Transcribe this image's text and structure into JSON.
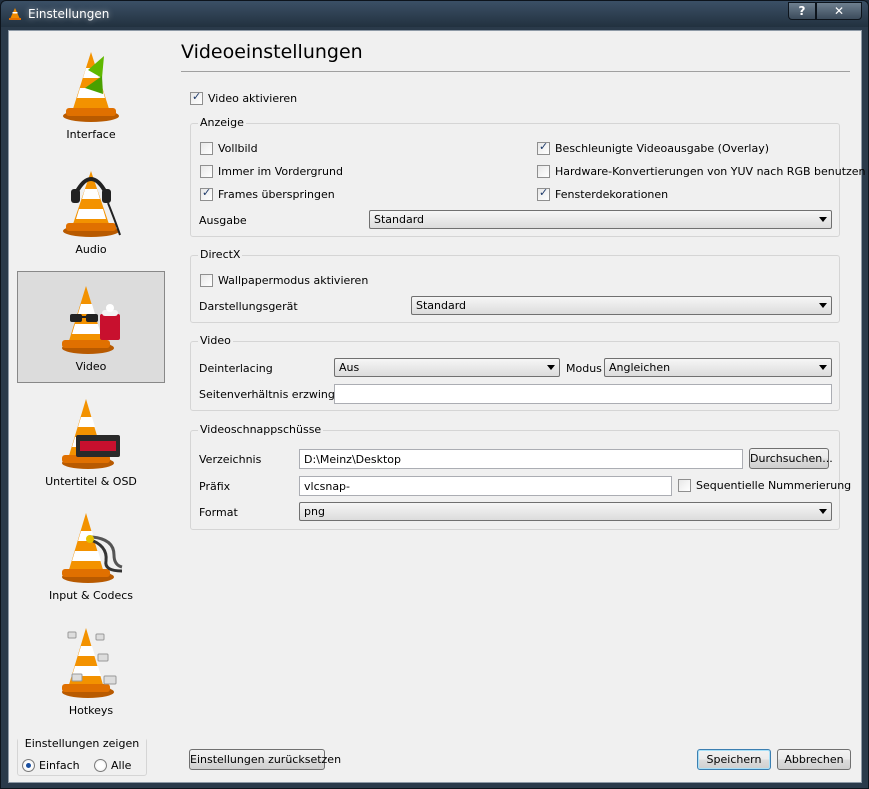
{
  "window": {
    "title": "Einstellungen",
    "help": "?",
    "close": "✕"
  },
  "sidebar": {
    "items": [
      {
        "label": "Interface",
        "icon": "vlc-cone-icon"
      },
      {
        "label": "Audio",
        "icon": "vlc-cone-headphones-icon"
      },
      {
        "label": "Video",
        "icon": "vlc-cone-glasses-icon"
      },
      {
        "label": "Untertitel & OSD",
        "icon": "vlc-cone-subtitles-icon"
      },
      {
        "label": "Input & Codecs",
        "icon": "vlc-cone-cables-icon"
      },
      {
        "label": "Hotkeys",
        "icon": "vlc-cone-keyboard-icon"
      }
    ],
    "selected": "Video",
    "show": {
      "title": "Einstellungen zeigen",
      "simple": "Einfach",
      "all": "Alle",
      "selected": "Einfach"
    }
  },
  "main": {
    "title": "Videoeinstellungen",
    "enable_video": {
      "label": "Video aktivieren",
      "checked": true
    },
    "anzeige": {
      "title": "Anzeige",
      "options": [
        {
          "label": "Vollbild",
          "checked": false
        },
        {
          "label": "Immer im Vordergrund",
          "checked": false
        },
        {
          "label": "Frames überspringen",
          "checked": true
        },
        {
          "label": "Beschleunigte Videoausgabe (Overlay)",
          "checked": true
        },
        {
          "label": "Hardware-Konvertierungen von YUV nach RGB benutzen",
          "checked": false
        },
        {
          "label": "Fensterdekorationen",
          "checked": true
        }
      ],
      "output_label": "Ausgabe",
      "output_value": "Standard"
    },
    "directx": {
      "title": "DirectX",
      "wallpaper": {
        "label": "Wallpapermodus aktivieren",
        "checked": false
      },
      "device_label": "Darstellungsgerät",
      "device_value": "Standard"
    },
    "video": {
      "title": "Video",
      "deinterlacing_label": "Deinterlacing",
      "deinterlacing_value": "Aus",
      "mode_label": "Modus",
      "mode_value": "Angleichen",
      "aspect_label": "Seitenverhältnis erzwingen",
      "aspect_value": ""
    },
    "snapshots": {
      "title": "Videoschnappschüsse",
      "directory_label": "Verzeichnis",
      "directory_value": "D:\\Meinz\\Desktop",
      "browse": "Durchsuchen...",
      "prefix_label": "Präfix",
      "prefix_value": "vlcsnap-",
      "sequential": {
        "label": "Sequentielle Nummerierung",
        "checked": false
      },
      "format_label": "Format",
      "format_value": "png"
    }
  },
  "buttons": {
    "reset": "Einstellungen zurücksetzen",
    "save": "Speichern",
    "cancel": "Abbrechen"
  }
}
